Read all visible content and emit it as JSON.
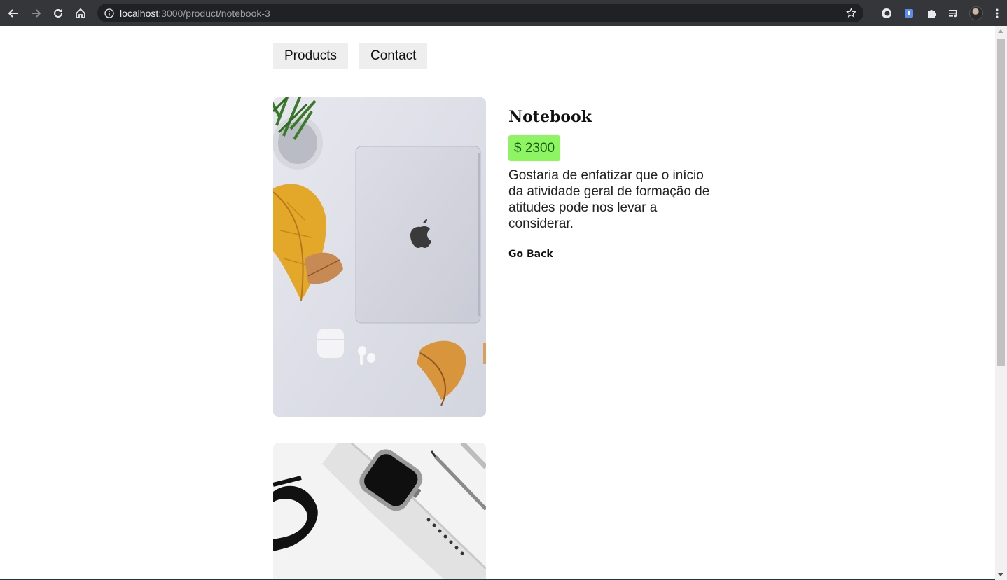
{
  "browser": {
    "url_host": "localhost",
    "url_rest": ":3000/product/notebook-3"
  },
  "nav": {
    "products_label": "Products",
    "contact_label": "Contact"
  },
  "product": {
    "title": "Notebook",
    "price": "$ 2300",
    "description": "Gostaria de enfatizar que o início da atividade geral de formação de atitudes pode nos levar a considerar.",
    "go_back_label": "Go Back"
  },
  "colors": {
    "price_badge_bg": "#8cf561",
    "chrome_bg": "#35363a"
  }
}
